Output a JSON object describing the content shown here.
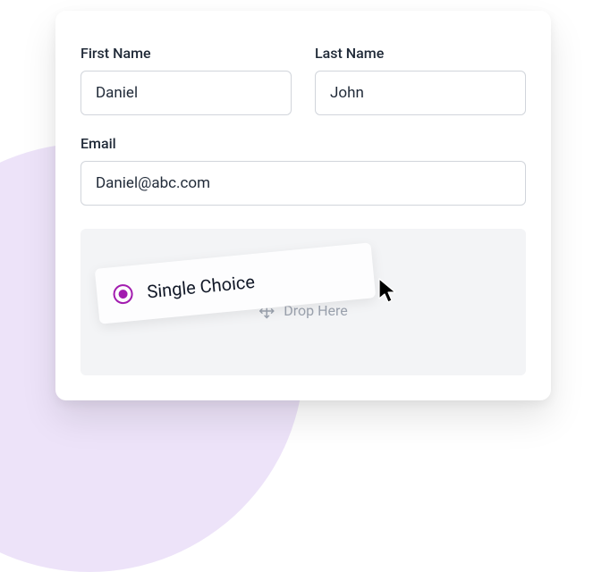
{
  "form": {
    "firstName": {
      "label": "First Name",
      "value": "Daniel"
    },
    "lastName": {
      "label": "Last Name",
      "value": "John"
    },
    "email": {
      "label": "Email",
      "value": "Daniel@abc.com"
    }
  },
  "dropzone": {
    "placeholder": "Drop Here"
  },
  "dragElement": {
    "label": "Single Choice",
    "icon": "radio-icon"
  },
  "colors": {
    "accent": "#a21caf",
    "blob": "#ede3f9"
  }
}
